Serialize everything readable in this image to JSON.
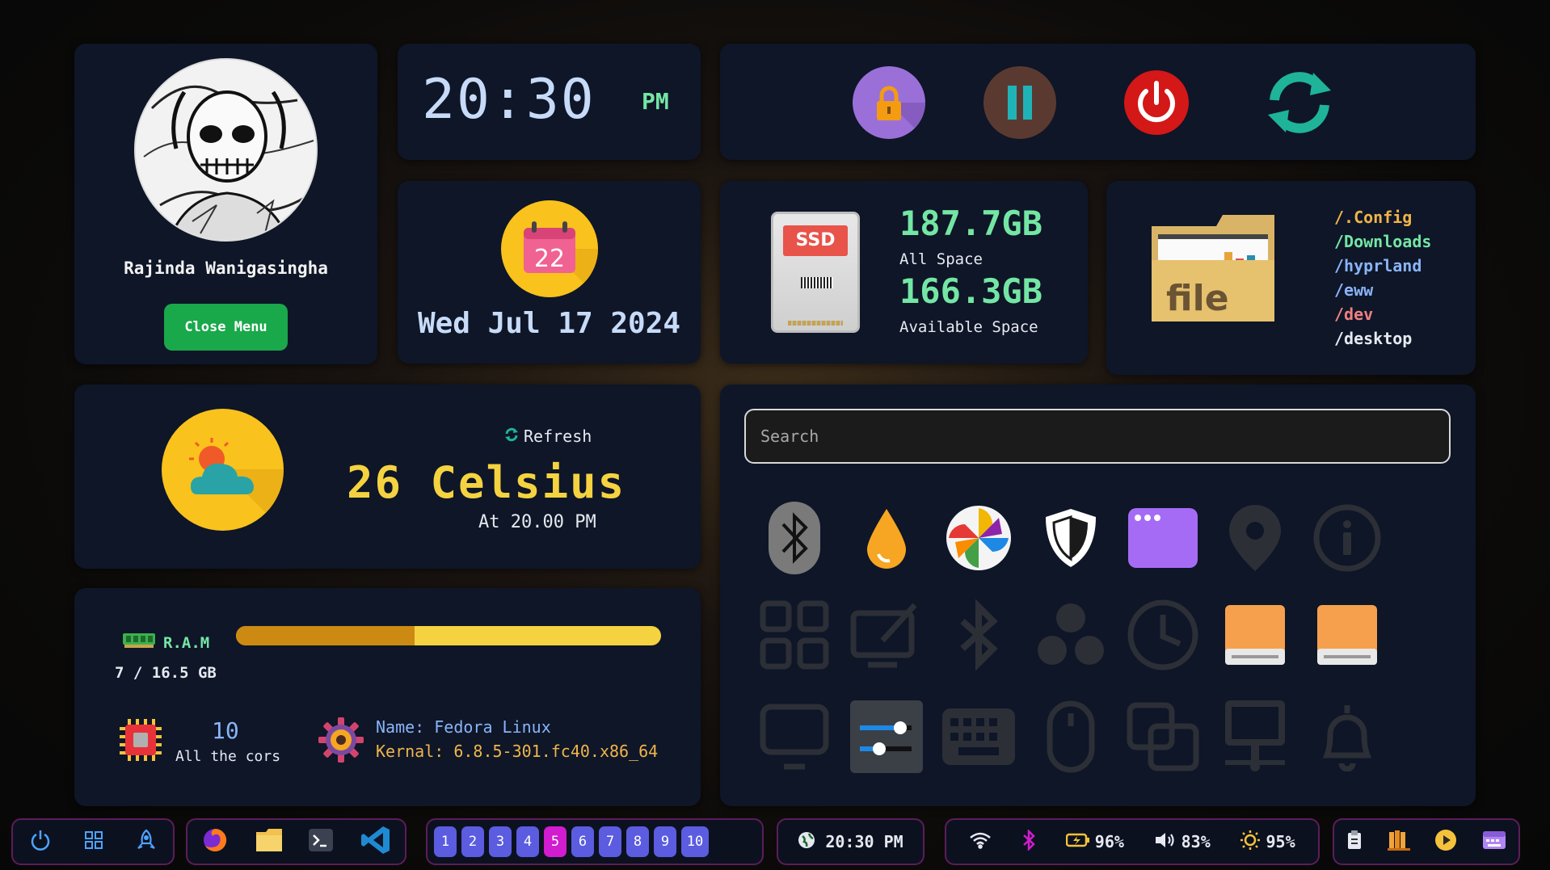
{
  "profile": {
    "name": "Rajinda Wanigasingha",
    "close_label": "Close Menu"
  },
  "clock": {
    "time": "20:30",
    "ampm": "PM"
  },
  "date": {
    "calendar_day": "22",
    "text": "Wed Jul 17 2024"
  },
  "power": {
    "buttons": [
      {
        "name": "lock-icon",
        "color": "#9b6fd8"
      },
      {
        "name": "pause-icon",
        "color": "#5a3a30"
      },
      {
        "name": "power-icon",
        "color": "#d41717"
      },
      {
        "name": "reload-icon",
        "color": "#1fb39a"
      }
    ]
  },
  "storage": {
    "ssd_label": "SSD",
    "all_value": "187.7GB",
    "all_label": "All Space",
    "available_value": "166.3GB",
    "available_label": "Available Space"
  },
  "folders": {
    "icon_text": "file",
    "items": [
      {
        "label": "/.Config",
        "color": "#f0b44a"
      },
      {
        "label": "/Downloads",
        "color": "#74e6a4"
      },
      {
        "label": "/hyprland",
        "color": "#8ab4f8"
      },
      {
        "label": "/eww",
        "color": "#8ab4f8"
      },
      {
        "label": "/dev",
        "color": "#f08080"
      },
      {
        "label": "/desktop",
        "color": "#e6e9f0"
      }
    ]
  },
  "weather": {
    "refresh_label": "Refresh",
    "temperature": "26 Celsius",
    "updated_at": "At 20.00 PM"
  },
  "system": {
    "ram_label": "R.A.M",
    "ram_used": 7,
    "ram_total": 16.5,
    "ram_fraction": 0.42,
    "ram_usage_text": "7 / 16.5 GB",
    "cores_count": "10",
    "cores_label": "All the cors",
    "os_name": "Name: Fedora Linux",
    "kernel": "Kernal: 6.8.5-301.fc40.x86_64"
  },
  "launcher": {
    "search_placeholder": "Search",
    "apps": [
      "bluetooth-icon",
      "water-drop-icon",
      "pinwheel-icon",
      "shield-icon",
      "window-icon",
      "location-icon",
      "info-icon",
      "grid-icon",
      "screen-edit-icon",
      "bluetooth-settings-icon",
      "circles-icon",
      "clock-icon",
      "drive-icon",
      "drive-icon",
      "monitor-icon",
      "sliders-icon",
      "keyboard-icon",
      "mouse-icon",
      "copy-icon",
      "desktop-network-icon",
      "bell-icon"
    ]
  },
  "taskbar": {
    "workspaces": [
      "1",
      "2",
      "3",
      "4",
      "5",
      "6",
      "7",
      "8",
      "9",
      "10"
    ],
    "active_workspace": "5",
    "time": "20:30 PM",
    "battery": "96%",
    "volume": "83%",
    "brightness": "95%"
  }
}
